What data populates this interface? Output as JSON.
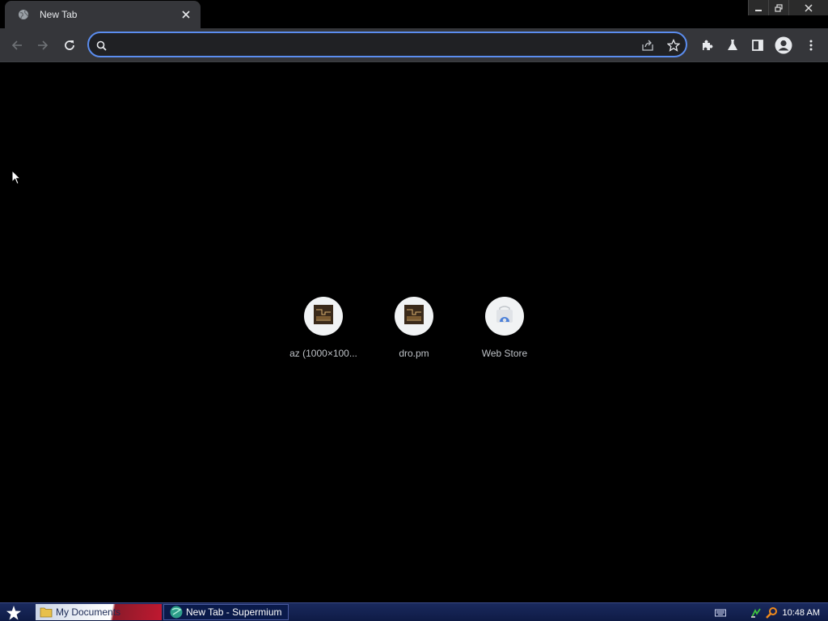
{
  "tab": {
    "title": "New Tab",
    "favicon_icon": "globe-icon",
    "close_icon": "close-icon"
  },
  "window_controls": {
    "minimize_icon": "minimize-icon",
    "restore_icon": "restore-icon",
    "close_icon": "close-icon"
  },
  "toolbar": {
    "back_icon": "arrow-left-icon",
    "forward_icon": "arrow-right-icon",
    "reload_icon": "reload-icon",
    "extensions_icon": "puzzle-icon",
    "labs_icon": "flask-icon",
    "side_panel_icon": "side-panel-icon",
    "profile_icon": "avatar-icon",
    "menu_icon": "kebab-menu-icon"
  },
  "omnibox": {
    "value": "",
    "placeholder": "",
    "search_icon": "search-icon",
    "share_icon": "share-icon",
    "bookmark_icon": "star-icon"
  },
  "shortcuts": [
    {
      "label": "az (1000×100...",
      "icon": "thumbnail-icon"
    },
    {
      "label": "dro.pm",
      "icon": "thumbnail-icon"
    },
    {
      "label": "Web Store",
      "icon": "web-store-icon"
    }
  ],
  "taskbar": {
    "start_icon": "star-icon",
    "items": [
      {
        "label": "My Documents",
        "icon": "folder-icon"
      },
      {
        "label": "New Tab - Supermium",
        "icon": "browser-icon"
      }
    ],
    "tray": {
      "keyboard_icon": "keyboard-icon",
      "network_icon": "network-icon",
      "search_icon": "magnifier-icon",
      "clock": "10:48 AM"
    }
  },
  "colors": {
    "background": "#000000",
    "chrome": "#35363a",
    "omnibox_border": "#5b8def",
    "taskbar": "#0e1a44"
  }
}
